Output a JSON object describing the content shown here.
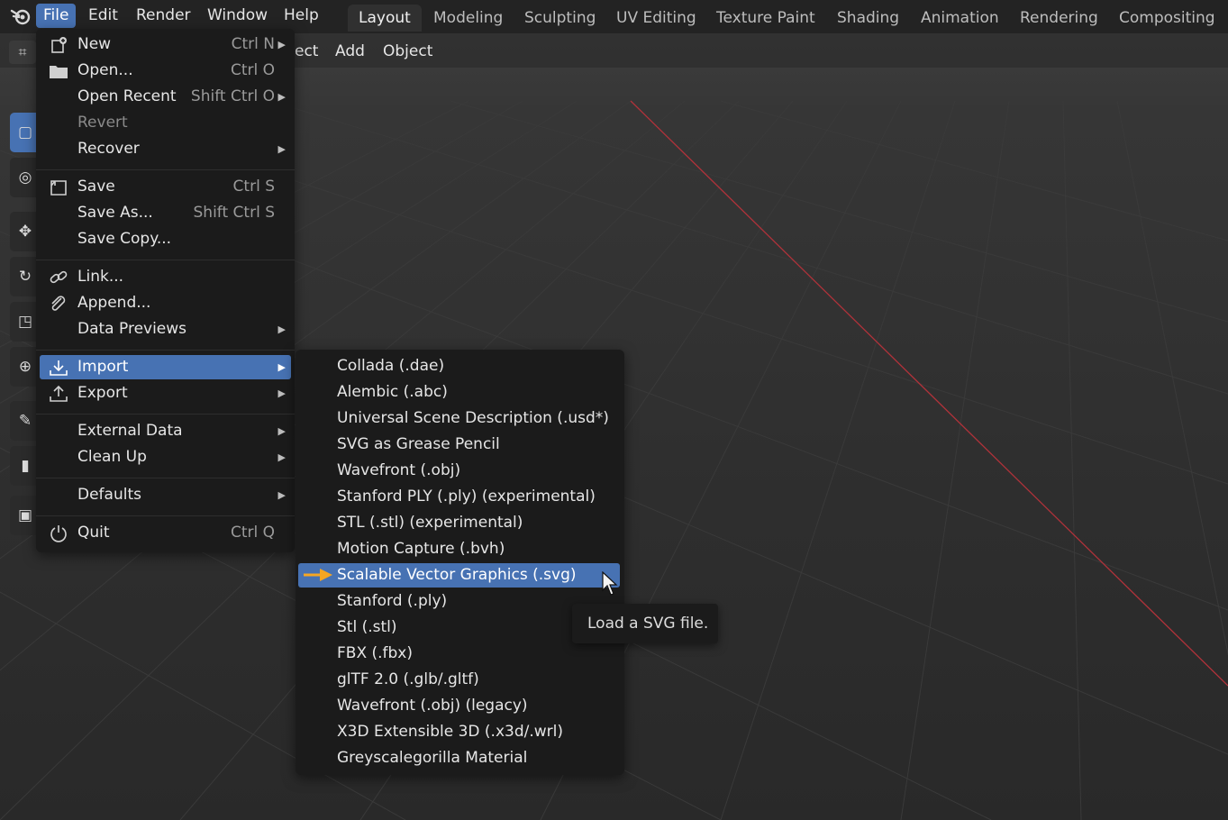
{
  "menubar": {
    "items": [
      {
        "label": "File"
      },
      {
        "label": "Edit"
      },
      {
        "label": "Render"
      },
      {
        "label": "Window"
      },
      {
        "label": "Help"
      }
    ]
  },
  "workspaces": {
    "tabs": [
      {
        "label": "Layout"
      },
      {
        "label": "Modeling"
      },
      {
        "label": "Sculpting"
      },
      {
        "label": "UV Editing"
      },
      {
        "label": "Texture Paint"
      },
      {
        "label": "Shading"
      },
      {
        "label": "Animation"
      },
      {
        "label": "Rendering"
      },
      {
        "label": "Compositing"
      }
    ],
    "active": "Layout"
  },
  "viewport_header": {
    "items": [
      {
        "label": "ect"
      },
      {
        "label": "Add"
      },
      {
        "label": "Object"
      }
    ]
  },
  "file_menu": {
    "items": [
      {
        "label": "New",
        "shortcut": "Ctrl N",
        "icon": "new-file-icon",
        "submenu": true
      },
      {
        "label": "Open...",
        "shortcut": "Ctrl O",
        "icon": "folder-icon"
      },
      {
        "label": "Open Recent",
        "shortcut": "Shift Ctrl O",
        "submenu": true
      },
      {
        "label": "Revert",
        "disabled": true
      },
      {
        "label": "Recover",
        "submenu": true
      },
      {
        "label": "Save",
        "shortcut": "Ctrl S",
        "icon": "save-icon"
      },
      {
        "label": "Save As...",
        "shortcut": "Shift Ctrl S"
      },
      {
        "label": "Save Copy..."
      },
      {
        "label": "Link...",
        "icon": "link-icon"
      },
      {
        "label": "Append...",
        "icon": "paperclip-icon"
      },
      {
        "label": "Data Previews",
        "submenu": true
      },
      {
        "label": "Import",
        "icon": "import-icon",
        "submenu": true,
        "highlighted": true
      },
      {
        "label": "Export",
        "icon": "export-icon",
        "submenu": true
      },
      {
        "label": "External Data",
        "submenu": true
      },
      {
        "label": "Clean Up",
        "submenu": true
      },
      {
        "label": "Defaults",
        "submenu": true
      },
      {
        "label": "Quit",
        "shortcut": "Ctrl Q",
        "icon": "power-icon"
      }
    ]
  },
  "import_menu": {
    "items": [
      {
        "label": "Collada (.dae)"
      },
      {
        "label": "Alembic (.abc)"
      },
      {
        "label": "Universal Scene Description (.usd*)"
      },
      {
        "label": "SVG as Grease Pencil"
      },
      {
        "label": "Wavefront (.obj)"
      },
      {
        "label": "Stanford PLY (.ply) (experimental)"
      },
      {
        "label": "STL (.stl) (experimental)"
      },
      {
        "label": "Motion Capture (.bvh)"
      },
      {
        "label": "Scalable Vector Graphics (.svg)",
        "highlighted": true
      },
      {
        "label": "Stanford (.ply)"
      },
      {
        "label": "Stl (.stl)"
      },
      {
        "label": "FBX (.fbx)"
      },
      {
        "label": "glTF 2.0 (.glb/.gltf)"
      },
      {
        "label": "Wavefront (.obj) (legacy)"
      },
      {
        "label": "X3D Extensible 3D (.x3d/.wrl)"
      },
      {
        "label": "Greyscalegorilla Material"
      }
    ]
  },
  "tooltip": {
    "text": "Load a SVG file."
  },
  "colors": {
    "accent": "#4772b3",
    "menu_bg": "#1b1b1b",
    "pointer_arrow": "#f5a623",
    "x_axis": "#b0323a"
  }
}
